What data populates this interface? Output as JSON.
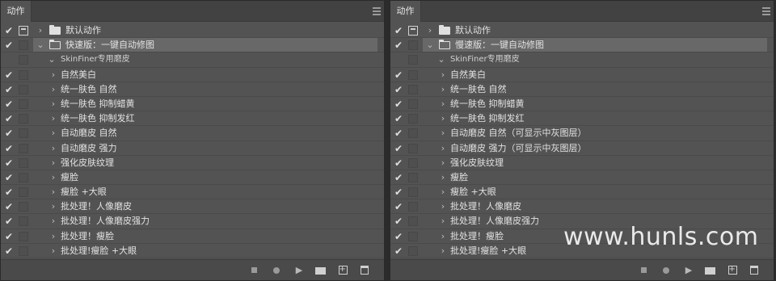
{
  "left": {
    "tab_label": "动作",
    "rows": [
      {
        "check": "✔",
        "dialog_on": true,
        "chevron": "›",
        "folder": "closed",
        "label": "默认动作",
        "selected": false,
        "level": 0
      },
      {
        "check": "✔",
        "dialog_on": false,
        "chevron": "⌄",
        "folder": "open",
        "label": "快速版：一键自动修图",
        "selected": true,
        "level": 0
      },
      {
        "check": "",
        "dialog_on": false,
        "chevron": "⌄",
        "folder": "none",
        "label": "SkinFiner专用磨皮",
        "selected": false,
        "level": 1
      },
      {
        "check": "✔",
        "dialog_on": false,
        "chevron": "›",
        "folder": "none",
        "label": "自然美白",
        "selected": false,
        "level": 2
      },
      {
        "check": "✔",
        "dialog_on": false,
        "chevron": "›",
        "folder": "none",
        "label": "统一肤色 自然",
        "selected": false,
        "level": 2
      },
      {
        "check": "✔",
        "dialog_on": false,
        "chevron": "›",
        "folder": "none",
        "label": "统一肤色 抑制蜡黄",
        "selected": false,
        "level": 2
      },
      {
        "check": "✔",
        "dialog_on": false,
        "chevron": "›",
        "folder": "none",
        "label": "统一肤色 抑制发红",
        "selected": false,
        "level": 2
      },
      {
        "check": "✔",
        "dialog_on": false,
        "chevron": "›",
        "folder": "none",
        "label": "自动磨皮  自然",
        "selected": false,
        "level": 2
      },
      {
        "check": "✔",
        "dialog_on": false,
        "chevron": "›",
        "folder": "none",
        "label": "自动磨皮  强力",
        "selected": false,
        "level": 2
      },
      {
        "check": "✔",
        "dialog_on": false,
        "chevron": "›",
        "folder": "none",
        "label": "强化皮肤纹理",
        "selected": false,
        "level": 2
      },
      {
        "check": "✔",
        "dialog_on": false,
        "chevron": "›",
        "folder": "none",
        "label": "瘦脸",
        "selected": false,
        "level": 2
      },
      {
        "check": "✔",
        "dialog_on": false,
        "chevron": "›",
        "folder": "none",
        "label": "瘦脸 +大眼",
        "selected": false,
        "level": 2
      },
      {
        "check": "✔",
        "dialog_on": false,
        "chevron": "›",
        "folder": "none",
        "label": "批处理！人像磨皮",
        "selected": false,
        "level": 2
      },
      {
        "check": "✔",
        "dialog_on": false,
        "chevron": "›",
        "folder": "none",
        "label": "批处理！人像磨皮强力",
        "selected": false,
        "level": 2
      },
      {
        "check": "✔",
        "dialog_on": false,
        "chevron": "›",
        "folder": "none",
        "label": "批处理！瘦脸",
        "selected": false,
        "level": 2
      },
      {
        "check": "✔",
        "dialog_on": false,
        "chevron": "›",
        "folder": "none",
        "label": "批处理!瘦脸 +大眼",
        "selected": false,
        "level": 2
      }
    ]
  },
  "right": {
    "tab_label": "动作",
    "rows": [
      {
        "check": "✔",
        "dialog_on": true,
        "chevron": "›",
        "folder": "closed",
        "label": "默认动作",
        "selected": false,
        "level": 0
      },
      {
        "check": "✔",
        "dialog_on": false,
        "chevron": "⌄",
        "folder": "open",
        "label": "慢速版：一键自动修图",
        "selected": true,
        "level": 0
      },
      {
        "check": "",
        "dialog_on": false,
        "chevron": "⌄",
        "folder": "none",
        "label": "SkinFiner专用磨皮",
        "selected": false,
        "level": 1
      },
      {
        "check": "✔",
        "dialog_on": false,
        "chevron": "›",
        "folder": "none",
        "label": "自然美白",
        "selected": false,
        "level": 2
      },
      {
        "check": "✔",
        "dialog_on": false,
        "chevron": "›",
        "folder": "none",
        "label": "统一肤色 自然",
        "selected": false,
        "level": 2
      },
      {
        "check": "✔",
        "dialog_on": false,
        "chevron": "›",
        "folder": "none",
        "label": "统一肤色 抑制蜡黄",
        "selected": false,
        "level": 2
      },
      {
        "check": "✔",
        "dialog_on": false,
        "chevron": "›",
        "folder": "none",
        "label": "统一肤色 抑制发红",
        "selected": false,
        "level": 2
      },
      {
        "check": "✔",
        "dialog_on": false,
        "chevron": "›",
        "folder": "none",
        "label": "自动磨皮  自然（可显示中灰图层）",
        "selected": false,
        "level": 2
      },
      {
        "check": "✔",
        "dialog_on": false,
        "chevron": "›",
        "folder": "none",
        "label": "自动磨皮  强力（可显示中灰图层）",
        "selected": false,
        "level": 2
      },
      {
        "check": "✔",
        "dialog_on": false,
        "chevron": "›",
        "folder": "none",
        "label": "强化皮肤纹理",
        "selected": false,
        "level": 2
      },
      {
        "check": "✔",
        "dialog_on": false,
        "chevron": "›",
        "folder": "none",
        "label": "瘦脸",
        "selected": false,
        "level": 2
      },
      {
        "check": "✔",
        "dialog_on": false,
        "chevron": "›",
        "folder": "none",
        "label": "瘦脸 +大眼",
        "selected": false,
        "level": 2
      },
      {
        "check": "✔",
        "dialog_on": false,
        "chevron": "›",
        "folder": "none",
        "label": "批处理！人像磨皮",
        "selected": false,
        "level": 2
      },
      {
        "check": "✔",
        "dialog_on": false,
        "chevron": "›",
        "folder": "none",
        "label": "批处理！人像磨皮强力",
        "selected": false,
        "level": 2
      },
      {
        "check": "✔",
        "dialog_on": false,
        "chevron": "›",
        "folder": "none",
        "label": "批处理！瘦脸",
        "selected": false,
        "level": 2
      },
      {
        "check": "✔",
        "dialog_on": false,
        "chevron": "›",
        "folder": "none",
        "label": "批处理!瘦脸 +大眼",
        "selected": false,
        "level": 2
      }
    ]
  },
  "bottom_icons": [
    "stop-icon",
    "record-icon",
    "play-icon",
    "new-set-folder-icon",
    "new-action-icon",
    "trash-icon"
  ],
  "watermark": "www.hunls.com",
  "colors": {
    "panel_bg": "#535353",
    "tab_bar": "#424242",
    "selected_row": "#686868",
    "text": "#e2e2e2"
  }
}
